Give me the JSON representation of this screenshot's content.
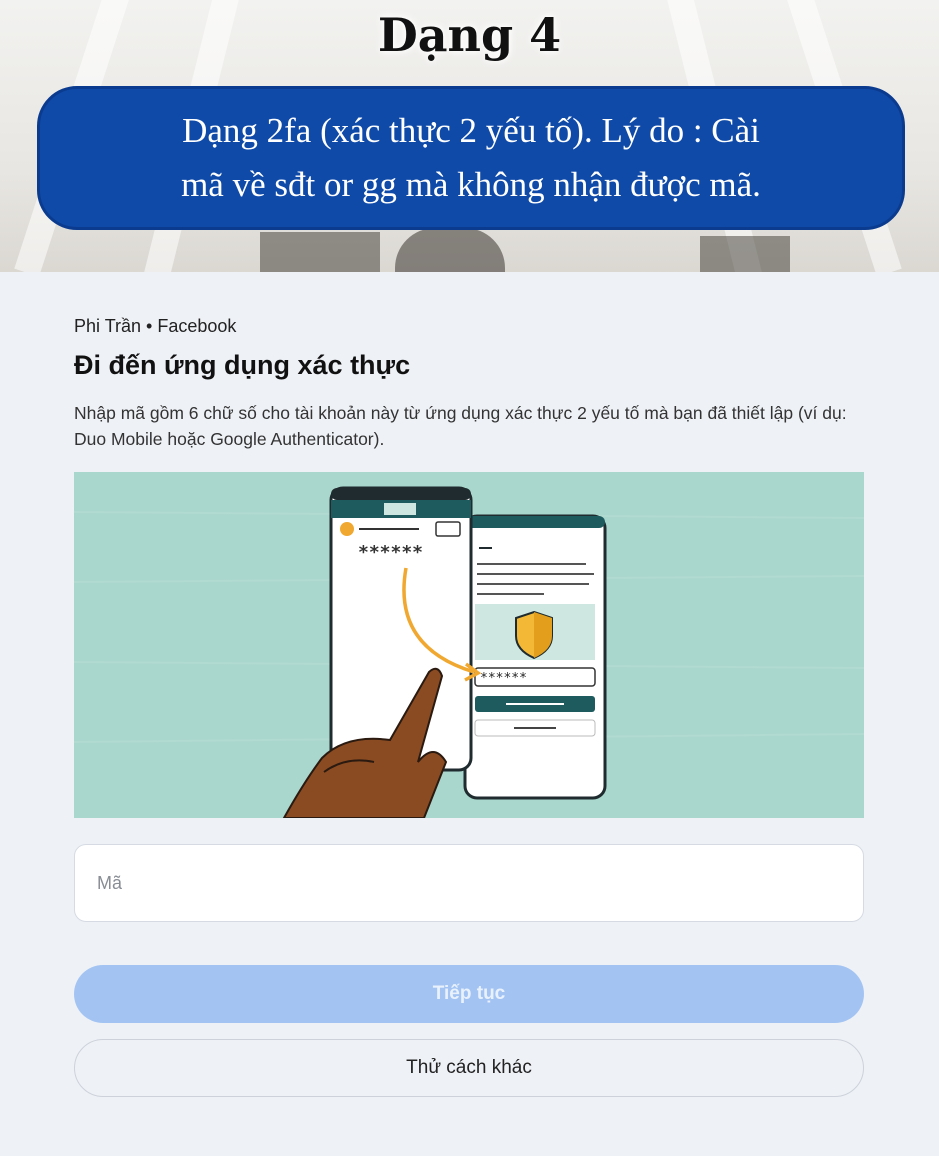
{
  "banner": {
    "heading": "Dạng 4",
    "callout_line1": "Dạng 2fa (xác thực 2 yếu tố). Lý do : Cài",
    "callout_line2": "mã về sđt or gg mà không nhận được mã.",
    "callout_color": "#0f4aa8"
  },
  "page": {
    "breadcrumb": "Phi Trần • Facebook",
    "title": "Đi đến ứng dụng xác thực",
    "description": "Nhập mã gồm 6 chữ số cho tài khoản này từ ứng dụng xác thực 2 yếu tố mà bạn đã thiết lập (ví dụ: Duo Mobile hoặc Google Authenticator).",
    "illustration": {
      "masked_code_left": "******",
      "masked_code_right": "******",
      "background_color": "#a9d6cd",
      "accent_color": "#1e5b5e",
      "icons": [
        "phone-left-icon",
        "phone-right-icon",
        "shield-icon",
        "pointing-hand-icon",
        "arrow-icon"
      ]
    },
    "code_input": {
      "placeholder": "Mã",
      "value": ""
    },
    "continue_button": "Tiếp tục",
    "other_way_button": "Thử cách khác",
    "primary_color": "#a3c4f3"
  }
}
